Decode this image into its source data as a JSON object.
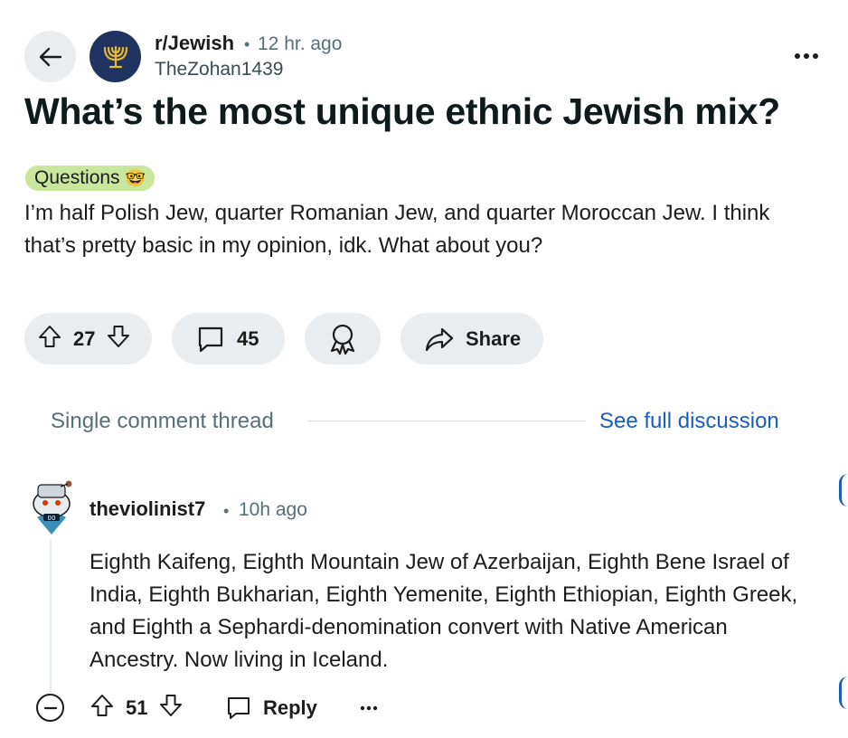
{
  "post": {
    "subreddit": "r/Jewish",
    "separator": "•",
    "time_ago": "12 hr. ago",
    "author": "TheZohan1439",
    "title": "What’s the most unique ethnic Jewish mix?",
    "flair": {
      "label": "Questions",
      "emoji": "🤓",
      "color": "#c8e69c"
    },
    "body": "I’m half Polish Jew, quarter Romanian Jew, and quarter Moroccan Jew. I think that’s pretty basic in my opinion, idk. What about you?",
    "vote_count": "27",
    "comment_count": "45",
    "share_label": "Share"
  },
  "thread": {
    "label": "Single comment thread",
    "full_discussion_link": "See full discussion"
  },
  "comment": {
    "username": "theviolinist7",
    "separator": "•",
    "time_ago": "10h ago",
    "body": "Eighth Kaifeng, Eighth Mountain Jew of Azerbaijan, Eighth Bene Israel of India, Eighth Bukharian, Eighth Yemenite, Eighth Ethiopian, Eighth Greek, and Eighth a Sephardi-denomination convert with Native American Ancestry. Now living in Iceland.",
    "vote_count": "51",
    "reply_label": "Reply"
  },
  "icons": {
    "back": "arrow-left-icon",
    "subreddit_avatar": "menorah-icon",
    "more": "ellipsis-icon",
    "upvote": "upvote-arrow-icon",
    "downvote": "downvote-arrow-icon",
    "comment": "speech-bubble-icon",
    "award": "award-ribbon-icon",
    "share": "share-arrow-icon",
    "collapse": "minus-circle-icon",
    "reply": "reply-bubble-icon"
  },
  "colors": {
    "link": "#1a5dbd",
    "pill_bg": "#eaedef",
    "subreddit_avatar_bg": "#203361",
    "menorah": "#e8b930",
    "meta_text": "#576f76"
  }
}
